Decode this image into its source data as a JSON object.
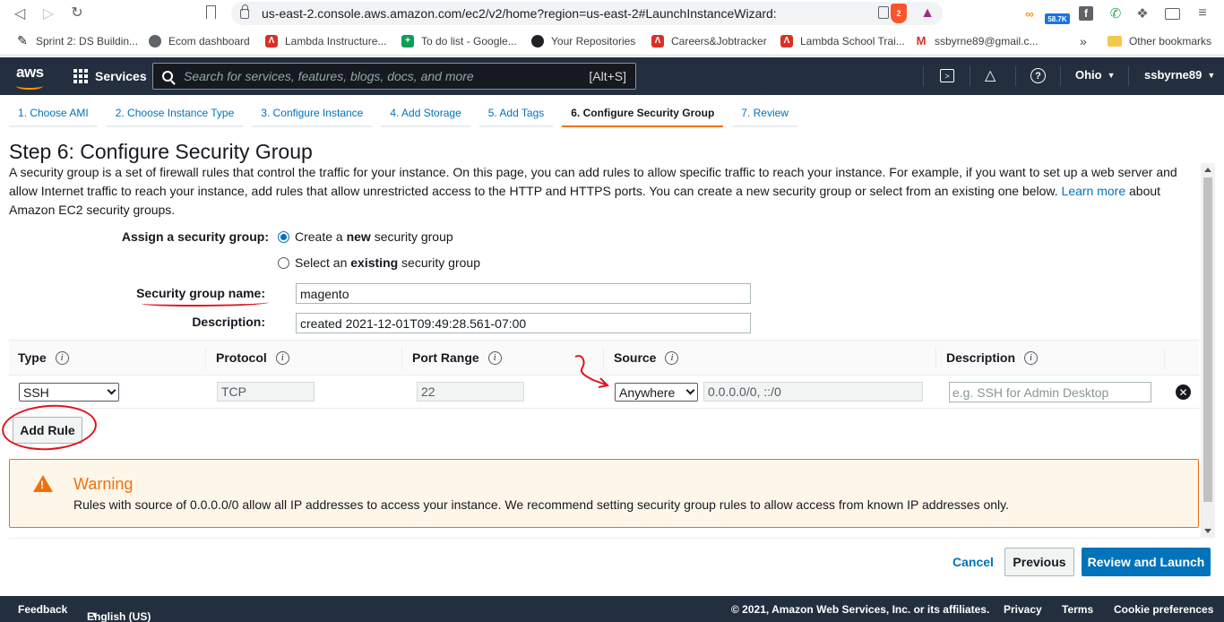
{
  "browser": {
    "url": "us-east-2.console.aws.amazon.com/ec2/v2/home?region=us-east-2#LaunchInstanceWizard:",
    "extension_badge": "58.7K",
    "brave_badge": "2",
    "bookmarks": [
      {
        "label": "Sprint 2: DS Buildin...",
        "icon": "pencil-icon",
        "color": "#202124"
      },
      {
        "label": "Ecom dashboard",
        "icon": "globe-icon",
        "color": "#5f6368"
      },
      {
        "label": "Lambda Instructure...",
        "icon": "lambda-icon",
        "color": "#d93025"
      },
      {
        "label": "To do list - Google...",
        "icon": "sheets-icon",
        "color": "#0f9d58"
      },
      {
        "label": "Your Repositories",
        "icon": "github-icon",
        "color": "#202124"
      },
      {
        "label": "Careers&Jobtracker",
        "icon": "lambda-icon",
        "color": "#d93025"
      },
      {
        "label": "Lambda School Trai...",
        "icon": "lambda-icon",
        "color": "#d93025"
      },
      {
        "label": "ssbyrne89@gmail.c...",
        "icon": "gmail-icon",
        "color": "#d93025"
      }
    ],
    "more_bookmarks": "»",
    "other_bookmarks": "Other bookmarks"
  },
  "aws_header": {
    "logo": "aws",
    "services": "Services",
    "search_placeholder": "Search for services, features, blogs, docs, and more",
    "search_shortcut": "[Alt+S]",
    "region": "Ohio",
    "user": "ssbyrne89"
  },
  "wizard": {
    "steps": [
      {
        "label": "1. Choose AMI",
        "active": false
      },
      {
        "label": "2. Choose Instance Type",
        "active": false
      },
      {
        "label": "3. Configure Instance",
        "active": false
      },
      {
        "label": "4. Add Storage",
        "active": false
      },
      {
        "label": "5. Add Tags",
        "active": false
      },
      {
        "label": "6. Configure Security Group",
        "active": true
      },
      {
        "label": "7. Review",
        "active": false
      }
    ],
    "title": "Step 6: Configure Security Group",
    "intro_text": "A security group is a set of firewall rules that control the traffic for your instance. On this page, you can add rules to allow specific traffic to reach your instance. For example, if you want to set up a web server and allow Internet traffic to reach your instance, add rules that allow unrestricted access to the HTTP and HTTPS ports. You can create a new security group or select from an existing one below.",
    "learn_more": "Learn more",
    "intro_tail": "about Amazon EC2 security groups."
  },
  "assign": {
    "label": "Assign a security group:",
    "option_new": {
      "pre": "Create a ",
      "bold": "new",
      "post": " security group",
      "selected": true
    },
    "option_existing": {
      "pre": "Select an ",
      "bold": "existing",
      "post": " security group",
      "selected": false
    }
  },
  "group_name": {
    "label": "Security group name:",
    "value": "magento"
  },
  "group_description": {
    "label": "Description:",
    "value": "created 2021-12-01T09:49:28.561-07:00"
  },
  "rules_table": {
    "headers": [
      "Type",
      "Protocol",
      "Port Range",
      "Source",
      "Description"
    ],
    "rows": [
      {
        "type": "SSH",
        "protocol": "TCP",
        "port_range": "22",
        "source_select": "Anywhere",
        "source_value": "0.0.0.0/0, ::/0",
        "description_placeholder": "e.g. SSH for Admin Desktop"
      }
    ],
    "add_rule": "Add Rule"
  },
  "warning": {
    "title": "Warning",
    "body": "Rules with source of 0.0.0.0/0 allow all IP addresses to access your instance. We recommend setting security group rules to allow access from known IP addresses only."
  },
  "actions": {
    "cancel": "Cancel",
    "previous": "Previous",
    "review_launch": "Review and Launch"
  },
  "footer": {
    "feedback": "Feedback",
    "language": "English (US)",
    "copyright": "© 2021, Amazon Web Services, Inc. or its affiliates.",
    "privacy": "Privacy",
    "terms": "Terms",
    "cookies": "Cookie preferences"
  },
  "colors": {
    "aws_nav": "#232f3e",
    "link": "#0073bb",
    "accent_orange": "#ec7211",
    "annotation_red": "#e0131a"
  }
}
